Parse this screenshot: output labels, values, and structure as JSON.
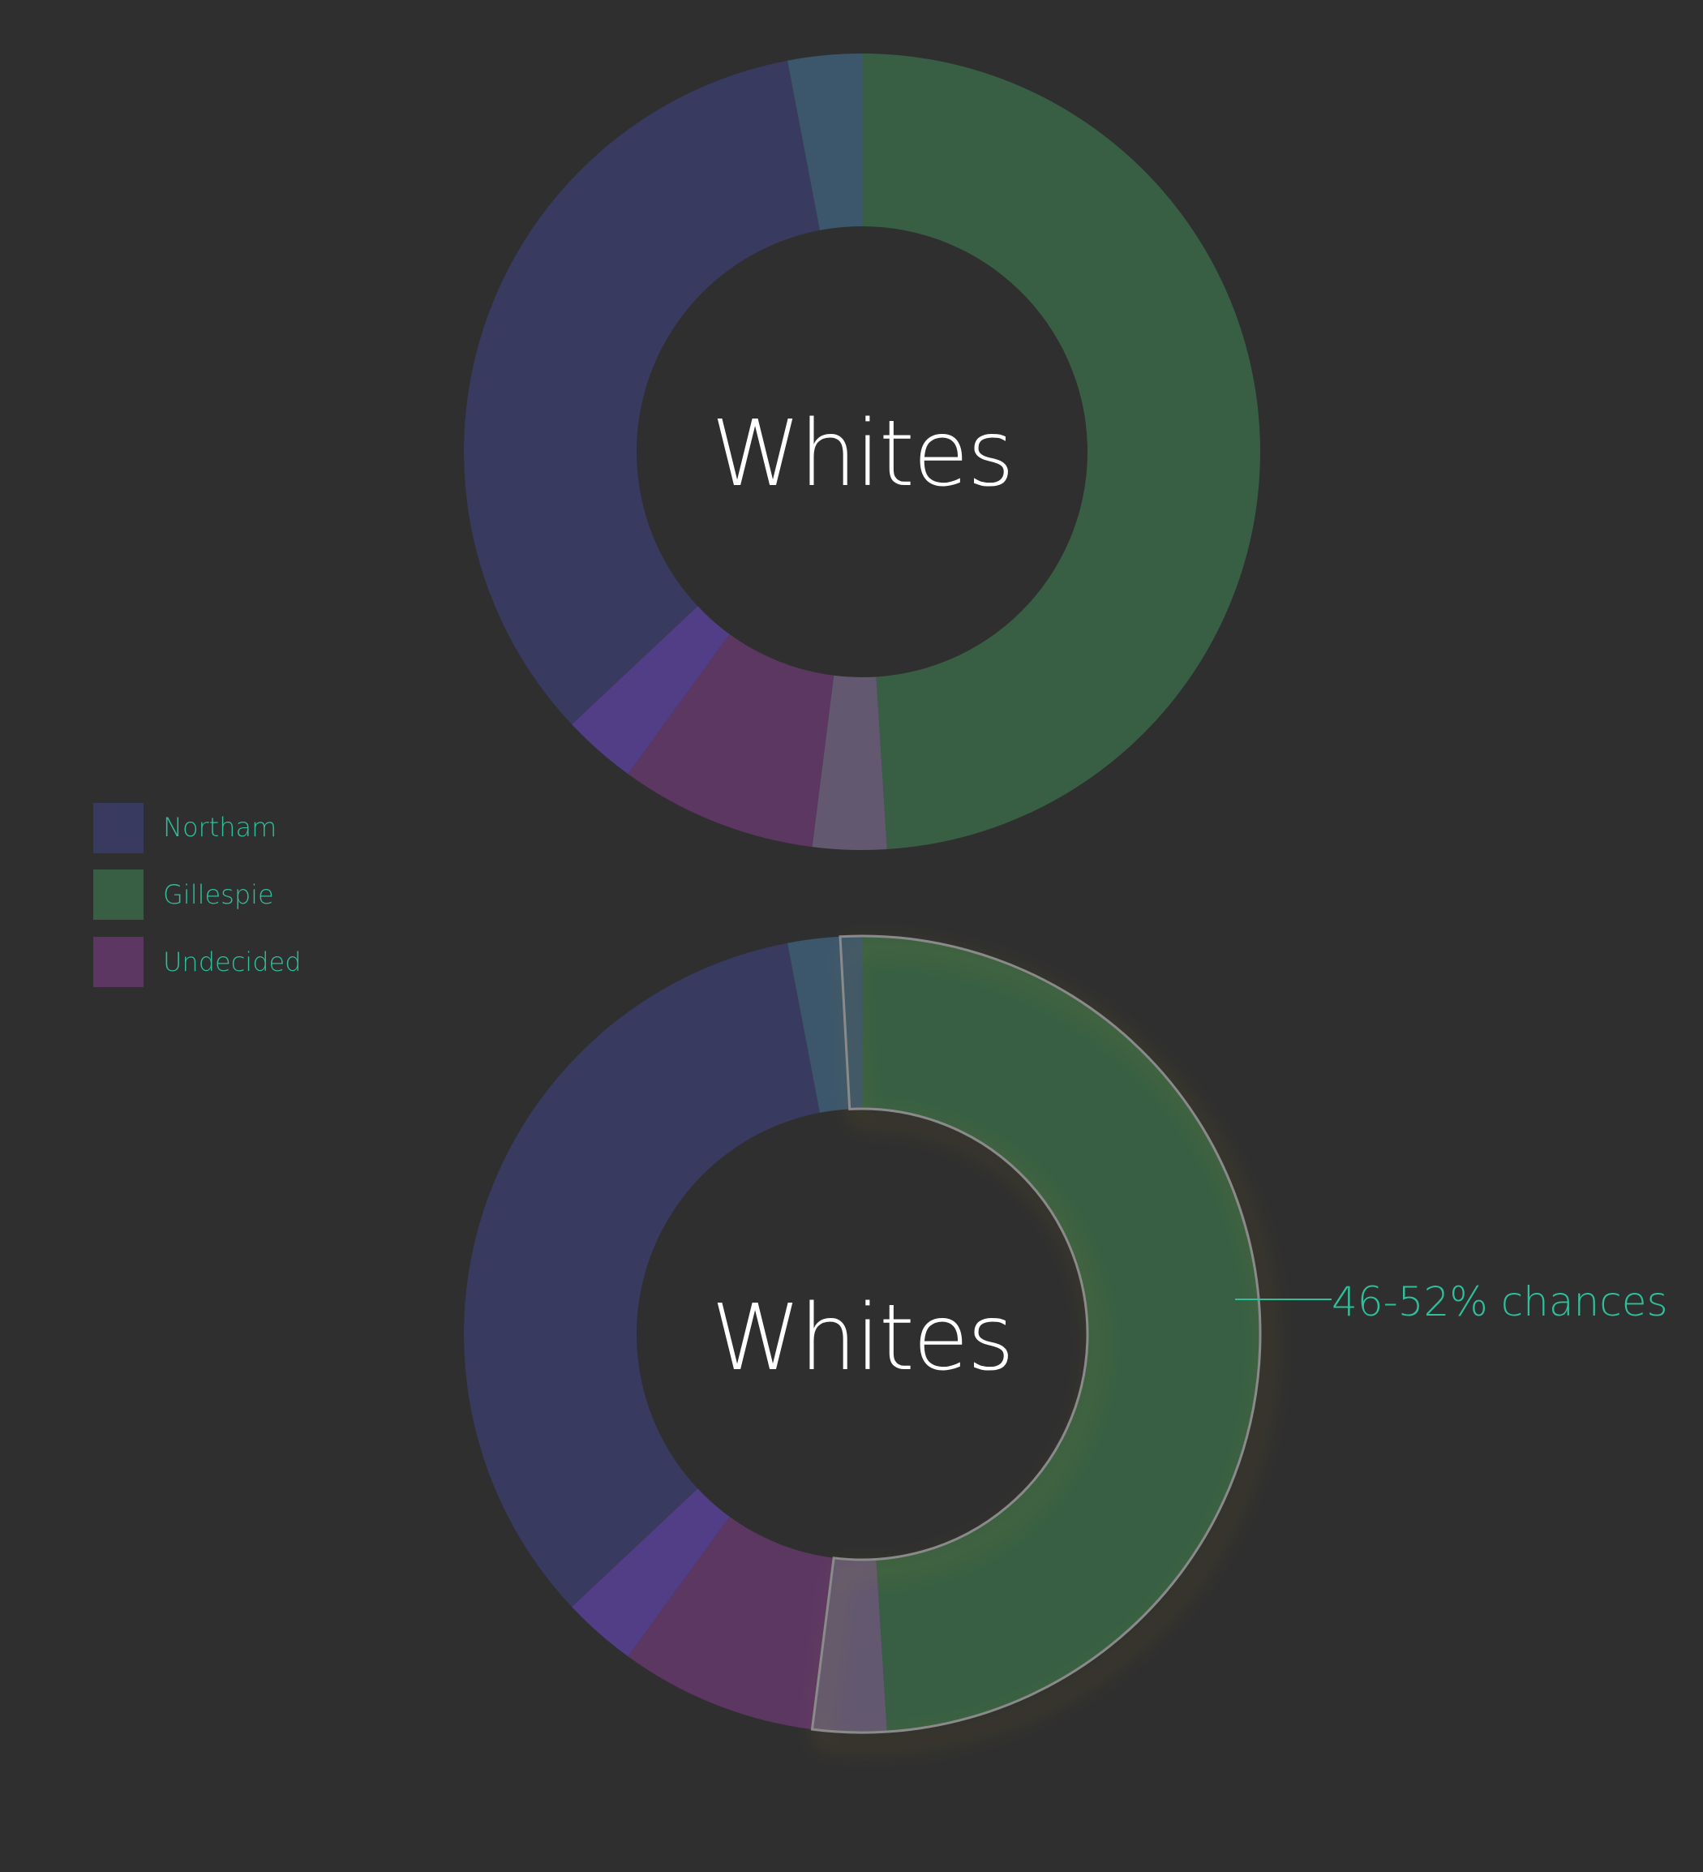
{
  "chart_data": [
    {
      "type": "donut",
      "center_label": "Whites",
      "highlighted": false,
      "slices": [
        {
          "name": "Gillespie",
          "value": 49.0,
          "color": "#385f43"
        },
        {
          "name": "Gillespie-margin",
          "value": 3.0,
          "color": "#625870"
        },
        {
          "name": "Undecided",
          "value": 8.0,
          "color": "#5c3762"
        },
        {
          "name": "Undecided-margin",
          "value": 3.0,
          "color": "#523e86"
        },
        {
          "name": "Northam",
          "value": 34.0,
          "color": "#393a5f"
        },
        {
          "name": "Northam-margin",
          "value": 3.0,
          "color": "#3c566b"
        }
      ]
    },
    {
      "type": "donut",
      "center_label": "Whites",
      "highlighted": true,
      "highlight_series": "Gillespie",
      "annotation": "46-52% chances",
      "slices": [
        {
          "name": "Gillespie",
          "value": 49.0,
          "color": "#385f43"
        },
        {
          "name": "Gillespie-margin",
          "value": 3.0,
          "color": "#625870"
        },
        {
          "name": "Undecided",
          "value": 8.0,
          "color": "#5c3762"
        },
        {
          "name": "Undecided-margin",
          "value": 3.0,
          "color": "#523e86"
        },
        {
          "name": "Northam",
          "value": 34.0,
          "color": "#393a5f"
        },
        {
          "name": "Northam-margin",
          "value": 3.0,
          "color": "#3c566b"
        }
      ]
    }
  ],
  "legend": {
    "placement": "left",
    "items": [
      {
        "label": "Northam",
        "color": "#393a5f"
      },
      {
        "label": "Gillespie",
        "color": "#385f43"
      },
      {
        "label": "Undecided",
        "color": "#5c3762"
      }
    ]
  },
  "colors": {
    "background": "#2f2f2f",
    "label_text": "#ffffff",
    "accent_text": "#2fbf9a",
    "highlight_glow": "#c9a12a",
    "highlight_stroke": "#8a8a8a"
  }
}
